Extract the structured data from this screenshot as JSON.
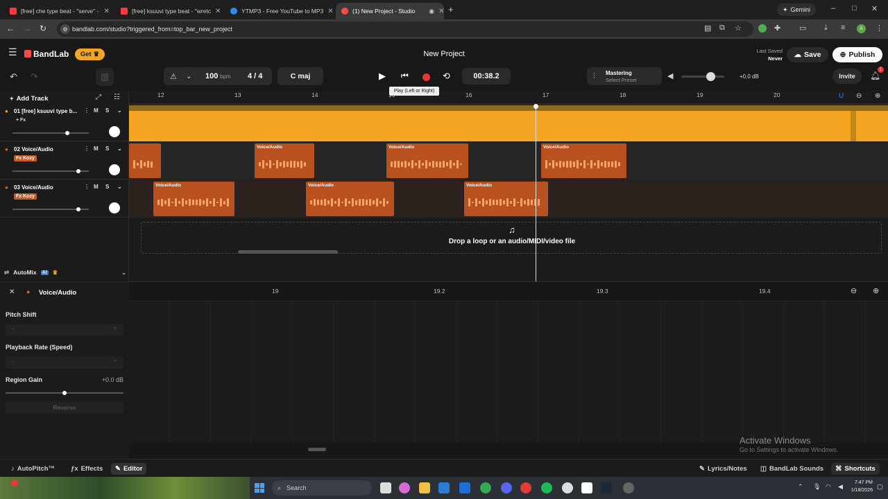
{
  "browser": {
    "tabs": [
      {
        "label": "[free] che type beat - \"serve\" - ",
        "favicon_color": "#ff3b3b"
      },
      {
        "label": "[free] ksuuvi type beat - \"wretc",
        "favicon_color": "#ff3b3b"
      },
      {
        "label": "YTMP3 - Free YouTube to MP3",
        "favicon_color": "#2d8cf0"
      },
      {
        "label": "(1) New Project - Studio",
        "favicon_color": "#ff4a4a"
      }
    ],
    "new_tab": "+",
    "gemini": "Gemini",
    "url": "bandlab.com/studio?triggered_from=top_bar_new_project",
    "window_controls": [
      "–",
      "□",
      "✕"
    ]
  },
  "header": {
    "logo": "BandLab",
    "get_label": "Get",
    "project_title": "New Project",
    "last_saved_label": "Last Saved",
    "last_saved_value": "Never",
    "save_label": "Save",
    "publish_label": "Publish"
  },
  "transport": {
    "bpm": "100",
    "bpm_unit": "bpm",
    "time_sig": "4 / 4",
    "key": "C maj",
    "time": "00:38.2",
    "tooltip": "Play (Left or Right)",
    "mastering_label": "Mastering",
    "mastering_sub": "Select Preset",
    "master_db": "+0.0 dB",
    "invite_label": "Invite",
    "notification_count": "1"
  },
  "add_track_label": "Add Track",
  "ruler_ticks": [
    "12",
    "13",
    "14",
    "15",
    "16",
    "17",
    "18",
    "19",
    "20"
  ],
  "tracks": [
    {
      "name": "01  [free] ksuuvi type b...",
      "fx": "+ Fx",
      "fx_plain": true,
      "mute": "M",
      "solo": "S",
      "color": "#f4a623"
    },
    {
      "name": "02  Voice/Audio",
      "fx": "Fx Kozy",
      "fx_plain": false,
      "mute": "M",
      "solo": "S",
      "color": "#b9501f"
    },
    {
      "name": "03  Voice/Audio",
      "fx": "Fx Kozy",
      "fx_plain": false,
      "mute": "M",
      "solo": "S",
      "color": "#b9501f"
    }
  ],
  "region_label": "Voice/Audio",
  "automix_label": "AutoMix",
  "automix_badge": "AI",
  "drop_text": "Drop a loop or an audio/MIDI/video file",
  "editor": {
    "title": "Voice/Audio",
    "pitch_shift": "Pitch Shift",
    "playback_rate": "Playback Rate (Speed)",
    "region_gain": "Region Gain",
    "region_gain_value": "+0.0 dB",
    "reverse": "Reverse",
    "ruler_ticks": [
      "19",
      "19.2",
      "19.3",
      "19.4"
    ]
  },
  "bottom": {
    "autopitch": "AutoPitch™",
    "effects": "Effects",
    "editor": "Editor",
    "lyrics": "Lyrics/Notes",
    "sounds": "BandLab Sounds",
    "shortcuts": "Shortcuts"
  },
  "watermark": {
    "line1": "Activate Windows",
    "line2": "Go to Settings to activate Windows."
  },
  "taskbar": {
    "search": "Search",
    "time": "7:47 PM",
    "date": "1/18/2026"
  }
}
